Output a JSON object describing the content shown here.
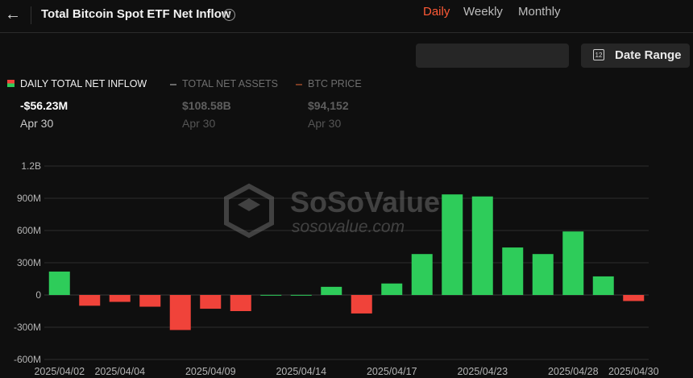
{
  "header": {
    "back_icon": "arrow-left-icon",
    "title": "Total Bitcoin Spot ETF Net Inflow",
    "info_glyph": "i"
  },
  "controls": {
    "periods": [
      {
        "label": "Daily",
        "active": true
      },
      {
        "label": "Weekly",
        "active": false
      },
      {
        "label": "Monthly",
        "active": false
      }
    ],
    "date_range": {
      "label": "Date Range",
      "icon": "calendar-icon",
      "icon_text": "12"
    }
  },
  "legend": [
    {
      "label": "DAILY TOTAL NET INFLOW",
      "value": "-$56.23M",
      "date": "Apr 30",
      "active": true
    },
    {
      "label": "TOTAL NET ASSETS",
      "value": "$108.58B",
      "date": "Apr 30",
      "active": false
    },
    {
      "label": "BTC PRICE",
      "value": "$94,152",
      "date": "Apr 30",
      "active": false
    }
  ],
  "colors": {
    "positive": "#2ecc5a",
    "negative": "#f0433a",
    "accent": "#ff5a36",
    "grid": "#2c2c2c"
  },
  "watermark": {
    "brand": "SoSoValue",
    "url": "sosovalue.com"
  },
  "chart_data": {
    "type": "bar",
    "unit": "USD",
    "ylim": [
      -600000000,
      1200000000
    ],
    "yticks": [
      {
        "value": 1200000000,
        "label": "1.2B"
      },
      {
        "value": 900000000,
        "label": "900M"
      },
      {
        "value": 600000000,
        "label": "600M"
      },
      {
        "value": 300000000,
        "label": "300M"
      },
      {
        "value": 0,
        "label": "0"
      },
      {
        "value": -300000000,
        "label": "-300M"
      },
      {
        "value": -600000000,
        "label": "-600M"
      }
    ],
    "xtick_labels": [
      "2025/04/02",
      "2025/04/04",
      "2025/04/09",
      "2025/04/14",
      "2025/04/17",
      "2025/04/23",
      "2025/04/28",
      "2025/04/30"
    ],
    "grid": true,
    "categories": [
      "2025/04/02",
      "2025/04/03",
      "2025/04/04",
      "2025/04/07",
      "2025/04/08",
      "2025/04/09",
      "2025/04/10",
      "2025/04/11",
      "2025/04/14",
      "2025/04/15",
      "2025/04/16",
      "2025/04/17",
      "2025/04/21",
      "2025/04/22",
      "2025/04/23",
      "2025/04/24",
      "2025/04/25",
      "2025/04/28",
      "2025/04/29",
      "2025/04/30"
    ],
    "values": [
      218000000,
      -100000000,
      -64000000,
      -109000000,
      -326000000,
      -128000000,
      -150000000,
      1000000,
      1000000,
      76000000,
      -172000000,
      107000000,
      381000000,
      936000000,
      917000000,
      442000000,
      381000000,
      591000000,
      173000000,
      -56230000
    ]
  }
}
